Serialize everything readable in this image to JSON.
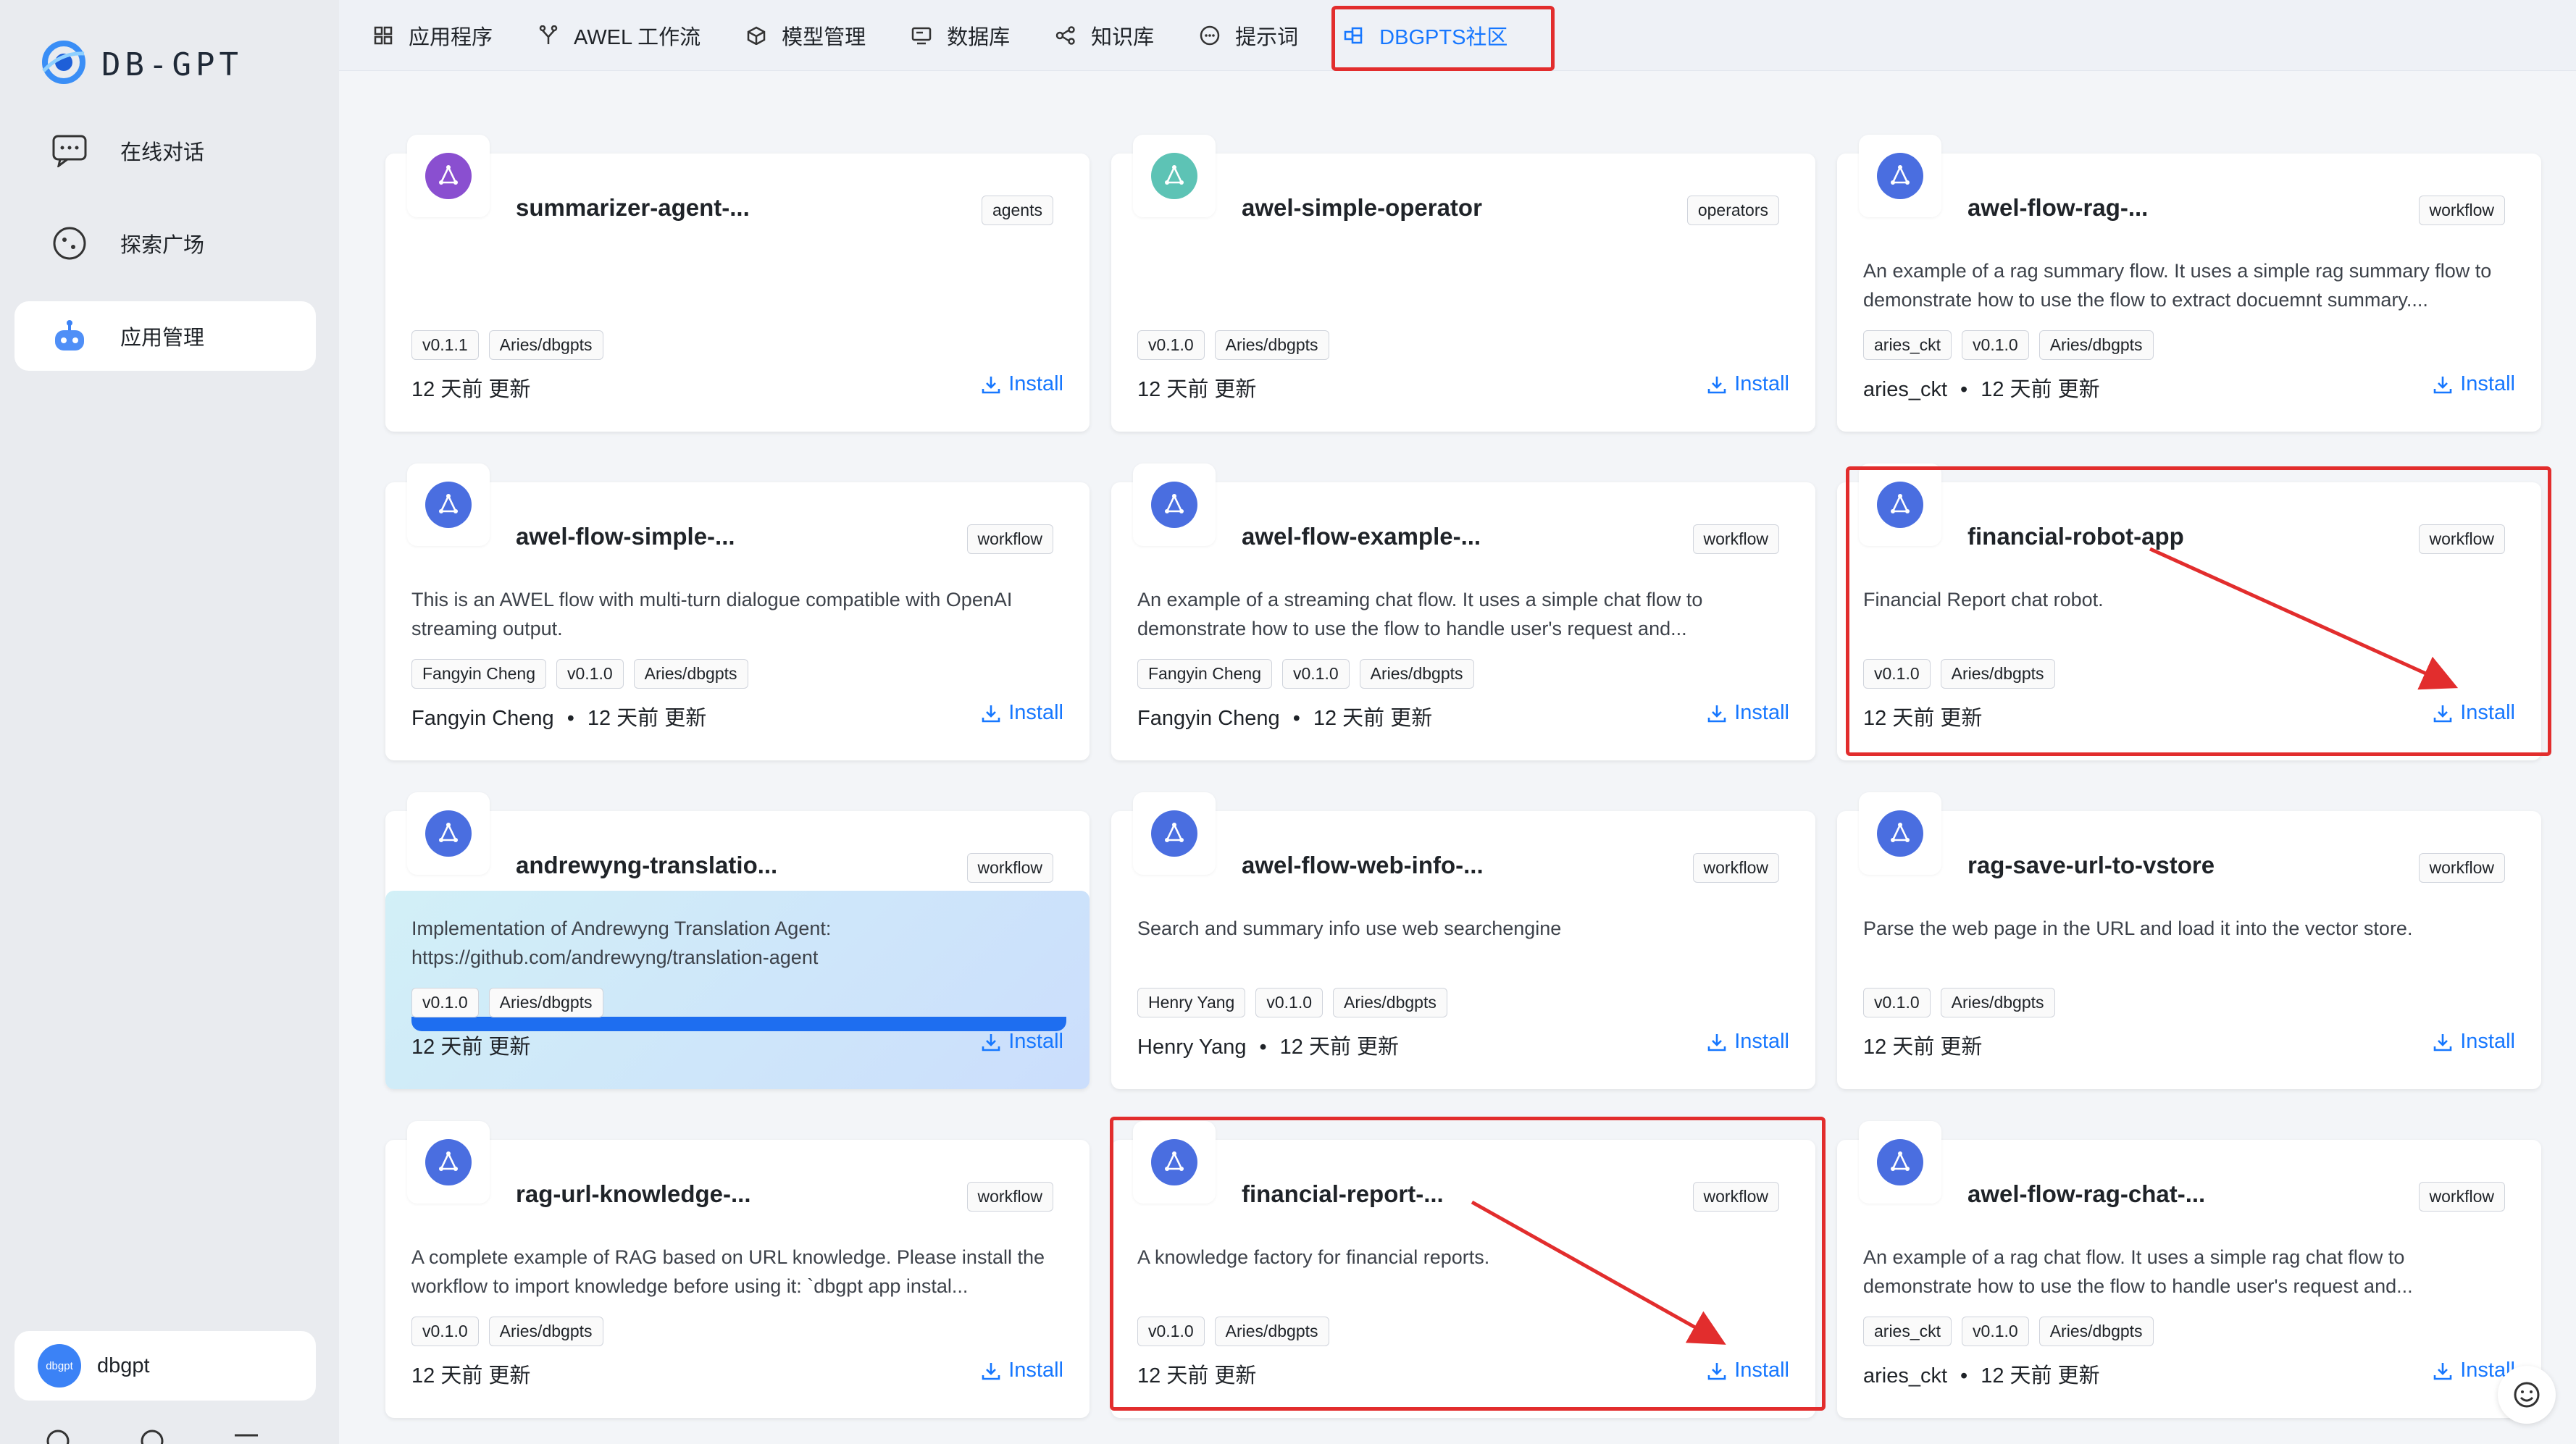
{
  "app": {
    "logo_text": "DB-GPT"
  },
  "sidebar": {
    "items": [
      {
        "label": "在线对话",
        "icon": "chat-bubble-icon"
      },
      {
        "label": "探索广场",
        "icon": "compass-icon"
      },
      {
        "label": "应用管理",
        "icon": "robot-icon",
        "active": true
      }
    ],
    "user": {
      "avatar": "dbgpt",
      "name": "dbgpt"
    }
  },
  "topnav": {
    "tabs": [
      {
        "label": "应用程序",
        "icon": "grid-icon"
      },
      {
        "label": "AWEL 工作流",
        "icon": "flow-icon"
      },
      {
        "label": "模型管理",
        "icon": "cube-icon"
      },
      {
        "label": "数据库",
        "icon": "database-icon"
      },
      {
        "label": "知识库",
        "icon": "share-nodes-icon"
      },
      {
        "label": "提示词",
        "icon": "message-dots-icon"
      },
      {
        "label": "DBGPTS社区",
        "icon": "community-icon",
        "active": true
      }
    ]
  },
  "install_label": "Install",
  "cards": [
    {
      "title": "summarizer-agent-...",
      "type": "agents",
      "desc": "",
      "tags": [
        "v0.1.1",
        "Aries/dbgpts"
      ],
      "author": "",
      "updated": "12 天前 更新",
      "icon_color": "#8a4fd0"
    },
    {
      "title": "awel-simple-operator",
      "type": "operators",
      "desc": "",
      "tags": [
        "v0.1.0",
        "Aries/dbgpts"
      ],
      "author": "",
      "updated": "12 天前 更新",
      "icon_color": "#5dc3b5"
    },
    {
      "title": "awel-flow-rag-...",
      "type": "workflow",
      "desc": "An example of a rag summary flow. It uses a simple rag summary flow to demonstrate how to use the flow to extract docuemnt summary....",
      "tags": [
        "aries_ckt",
        "v0.1.0",
        "Aries/dbgpts"
      ],
      "author": "aries_ckt",
      "updated": "12 天前 更新",
      "icon_color": "#4a6ee0"
    },
    {
      "title": "awel-flow-simple-...",
      "type": "workflow",
      "desc": "This is an AWEL flow with multi-turn dialogue compatible with OpenAI streaming output.",
      "tags": [
        "Fangyin Cheng",
        "v0.1.0",
        "Aries/dbgpts"
      ],
      "author": "Fangyin Cheng",
      "updated": "12 天前 更新",
      "icon_color": "#4a6ee0"
    },
    {
      "title": "awel-flow-example-...",
      "type": "workflow",
      "desc": "An example of a streaming chat flow. It uses a simple chat flow to demonstrate how to use the flow to handle user's request and...",
      "tags": [
        "Fangyin Cheng",
        "v0.1.0",
        "Aries/dbgpts"
      ],
      "author": "Fangyin Cheng",
      "updated": "12 天前 更新",
      "icon_color": "#4a6ee0"
    },
    {
      "title": "financial-robot-app",
      "type": "workflow",
      "desc": "Financial Report chat robot.",
      "tags": [
        "v0.1.0",
        "Aries/dbgpts"
      ],
      "author": "",
      "updated": "12 天前 更新",
      "icon_color": "#4a6ee0"
    },
    {
      "title": "andrewyng-translatio...",
      "type": "workflow",
      "desc": "Implementation of Andrewyng Translation Agent: https://github.com/andrewyng/translation-agent",
      "tags": [
        "v0.1.0",
        "Aries/dbgpts"
      ],
      "author": "",
      "updated": "12 天前 更新",
      "icon_color": "#4a6ee0",
      "hover": true
    },
    {
      "title": "awel-flow-web-info-...",
      "type": "workflow",
      "desc": "Search and summary info use web searchengine",
      "tags": [
        "Henry Yang",
        "v0.1.0",
        "Aries/dbgpts"
      ],
      "author": "Henry Yang",
      "updated": "12 天前 更新",
      "icon_color": "#4a6ee0"
    },
    {
      "title": "rag-save-url-to-vstore",
      "type": "workflow",
      "desc": "Parse the web page in the URL and load it into the vector store.",
      "tags": [
        "v0.1.0",
        "Aries/dbgpts"
      ],
      "author": "",
      "updated": "12 天前 更新",
      "icon_color": "#4a6ee0"
    },
    {
      "title": "rag-url-knowledge-...",
      "type": "workflow",
      "desc": "A complete example of RAG based on URL knowledge. Please install the workflow to import knowledge before using it: `dbgpt app instal...",
      "tags": [
        "v0.1.0",
        "Aries/dbgpts"
      ],
      "author": "",
      "updated": "12 天前 更新",
      "icon_color": "#4a6ee0"
    },
    {
      "title": "financial-report-...",
      "type": "workflow",
      "desc": "A knowledge factory for financial reports.",
      "tags": [
        "v0.1.0",
        "Aries/dbgpts"
      ],
      "author": "",
      "updated": "12 天前 更新",
      "icon_color": "#4a6ee0"
    },
    {
      "title": "awel-flow-rag-chat-...",
      "type": "workflow",
      "desc": "An example of a rag chat flow. It uses a simple rag chat flow to demonstrate how to use the flow to handle user's request and...",
      "tags": [
        "aries_ckt",
        "v0.1.0",
        "Aries/dbgpts"
      ],
      "author": "aries_ckt",
      "updated": "12 天前 更新",
      "icon_color": "#4a6ee0"
    }
  ],
  "colors": {
    "accent": "#1677ff",
    "annotation": "#e22d2d"
  }
}
